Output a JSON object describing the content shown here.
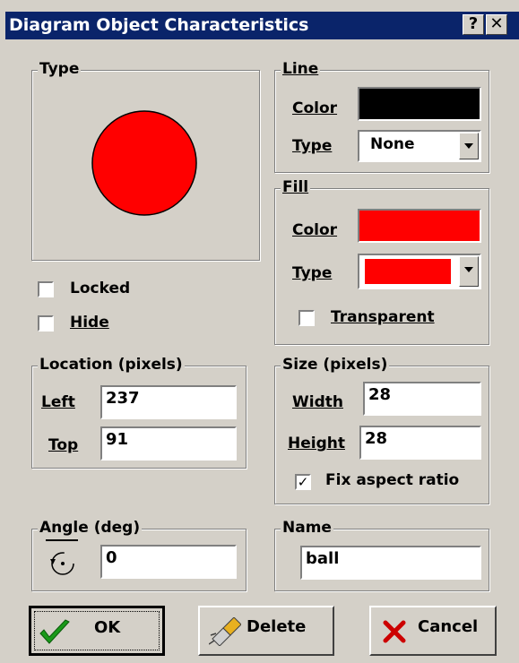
{
  "window": {
    "title": "Diagram Object Characteristics",
    "help_label": "?",
    "close_label": "✕"
  },
  "type_group": {
    "title": "Type",
    "shape_color": "#ff0000"
  },
  "checkboxes": {
    "locked": {
      "label": "Locked",
      "checked": false
    },
    "hide": {
      "label": "Hide",
      "checked": false
    }
  },
  "line_group": {
    "title": "Line",
    "color_label": "Color",
    "color_value": "#000000",
    "type_label": "Type",
    "type_value": "None"
  },
  "fill_group": {
    "title": "Fill",
    "color_label": "Color",
    "color_value": "#ff0000",
    "type_label": "Type",
    "type_value": "#ff0000",
    "transparent_label": "Transparent",
    "transparent_checked": false
  },
  "location_group": {
    "title": "Location (pixels)",
    "left_label": "Left",
    "left_value": "237",
    "top_label": "Top",
    "top_value": "91"
  },
  "size_group": {
    "title": "Size (pixels)",
    "width_label": "Width",
    "width_value": "28",
    "height_label": "Height",
    "height_value": "28",
    "fix_aspect_label": "Fix aspect ratio",
    "fix_aspect_checked": true
  },
  "angle_group": {
    "title": "Angle (deg)",
    "value": "0"
  },
  "name_group": {
    "title": "Name",
    "value": "ball"
  },
  "buttons": {
    "ok": "OK",
    "delete": "Delete",
    "cancel": "Cancel"
  }
}
